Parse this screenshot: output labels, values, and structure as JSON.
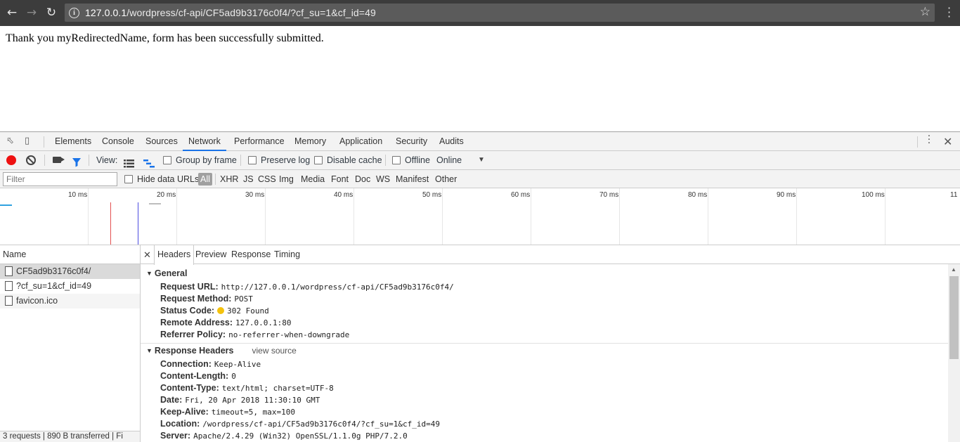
{
  "browser": {
    "url_host": "127.0.0.1",
    "url_path": "/wordpress/cf-api/CF5ad9b3176c0f4/?cf_su=1&cf_id=49"
  },
  "page": {
    "message": "Thank you myRedirectedName, form has been successfully submitted."
  },
  "devtools": {
    "tabs": [
      "Elements",
      "Console",
      "Sources",
      "Network",
      "Performance",
      "Memory",
      "Application",
      "Security",
      "Audits"
    ],
    "active_tab": "Network",
    "toolbar": {
      "view_label": "View:",
      "group_by_frame": "Group by frame",
      "preserve_log": "Preserve log",
      "disable_cache": "Disable cache",
      "offline": "Offline",
      "throttling": "Online"
    },
    "filter": {
      "placeholder": "Filter",
      "hide_data_urls": "Hide data URLs",
      "types": [
        "All",
        "XHR",
        "JS",
        "CSS",
        "Img",
        "Media",
        "Font",
        "Doc",
        "WS",
        "Manifest",
        "Other"
      ]
    },
    "timeline_ticks": [
      "10 ms",
      "20 ms",
      "30 ms",
      "40 ms",
      "50 ms",
      "60 ms",
      "70 ms",
      "80 ms",
      "90 ms",
      "100 ms",
      "11"
    ],
    "requests": {
      "column_name": "Name",
      "items": [
        "CF5ad9b3176c0f4/",
        "?cf_su=1&cf_id=49",
        "favicon.ico"
      ],
      "footer": "3 requests | 890 B transferred | Fi"
    },
    "detail_tabs": [
      "Headers",
      "Preview",
      "Response",
      "Timing"
    ],
    "general": {
      "title": "General",
      "rows": [
        {
          "k": "Request URL:",
          "v": "http://127.0.0.1/wordpress/cf-api/CF5ad9b3176c0f4/"
        },
        {
          "k": "Request Method:",
          "v": "POST"
        },
        {
          "k": "Status Code:",
          "v": "302 Found"
        },
        {
          "k": "Remote Address:",
          "v": "127.0.0.1:80"
        },
        {
          "k": "Referrer Policy:",
          "v": "no-referrer-when-downgrade"
        }
      ]
    },
    "response_headers": {
      "title": "Response Headers",
      "view_source": "view source",
      "rows": [
        {
          "k": "Connection:",
          "v": "Keep-Alive"
        },
        {
          "k": "Content-Length:",
          "v": "0"
        },
        {
          "k": "Content-Type:",
          "v": "text/html; charset=UTF-8"
        },
        {
          "k": "Date:",
          "v": "Fri, 20 Apr 2018 11:30:10 GMT"
        },
        {
          "k": "Keep-Alive:",
          "v": "timeout=5, max=100"
        },
        {
          "k": "Location:",
          "v": "/wordpress/cf-api/CF5ad9b3176c0f4/?cf_su=1&cf_id=49"
        },
        {
          "k": "Server:",
          "v": "Apache/2.4.29 (Win32) OpenSSL/1.1.0g PHP/7.2.0"
        }
      ]
    },
    "colors": {
      "status_dot": "#f4c20d",
      "record": "#ee1111",
      "active_tab_underline": "#1a73e8"
    }
  }
}
